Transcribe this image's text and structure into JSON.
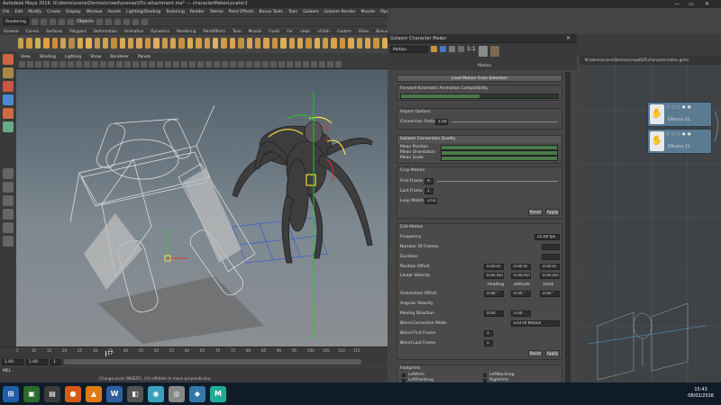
{
  "maya": {
    "title": "Autodesk Maya 2016: N:\\demo\\scene\\Demos\\crowd\\scenes\\05c-attachment.ma* --- characterMakerLocator1",
    "menus": [
      "File",
      "Edit",
      "Modify",
      "Create",
      "Display",
      "Window",
      "Assets",
      "Lighting/Shading",
      "Texturing",
      "Render",
      "Stereo",
      "Paint Effects",
      "Bonus Tools",
      "Toon",
      "Golaem",
      "Golaem Render",
      "Muscle",
      "Pipeline Cache",
      "Help"
    ],
    "mode_dropdown": "Rendering",
    "objects_label": "Objects",
    "shelf_tabs": [
      "General",
      "Curves",
      "Surfaces",
      "Polygons",
      "Deformation",
      "Animation",
      "Dynamics",
      "Rendering",
      "PaintEffects",
      "Toon",
      "Muscle",
      "Fluids",
      "Fur",
      "nHair",
      "nCloth",
      "Custom",
      "XGen",
      "Bonus",
      "Golaem"
    ],
    "shelf_colors": [
      "#c7a05a",
      "#d89a3a",
      "#c8b060",
      "#e0a040",
      "#d48b36",
      "#caa35b",
      "#b58a45",
      "#d6aa55",
      "#e2b25a",
      "#c9954a",
      "#d8a048",
      "#c58c40",
      "#dba854",
      "#cfa04d",
      "#d9a35a",
      "#c7973f",
      "#e0ad5c",
      "#cd9a48",
      "#d4a453",
      "#c8923e",
      "#dcaa55",
      "#d39c46",
      "#c99a4c",
      "#e1b15d",
      "#cf9b47",
      "#d6a552",
      "#c48f3f",
      "#daa651",
      "#cc9849",
      "#d7a250",
      "#c99443",
      "#ddb059",
      "#d09d48",
      "#d8a455",
      "#c6923f",
      "#e0ad5a",
      "#ce9a47",
      "#d5a352",
      "#ca9644",
      "#dcaa56",
      "#d19d49",
      "#d7a453",
      "#c7943f",
      "#dfac59"
    ],
    "panel_menus": [
      "View",
      "Shading",
      "Lighting",
      "Show",
      "Renderer",
      "Panels"
    ],
    "time_current": "17",
    "timeline_ticks": [
      "5",
      "10",
      "15",
      "20",
      "25",
      "30",
      "35",
      "40",
      "45",
      "50",
      "55",
      "60",
      "65",
      "70",
      "75",
      "80",
      "85",
      "90",
      "95",
      "100",
      "105",
      "110",
      "115"
    ],
    "range_start": "1.00",
    "range_inner": "1.00",
    "range_field": "1",
    "cmd_label": "MEL",
    "help_text": "Change pivot (INSERT). Ctrl+Middle to move perpendicular."
  },
  "golaem": {
    "window_title": "Golaem Character Maker",
    "motion_dropdown": "Motion",
    "toolbar_ratio": "1:1",
    "sub_label": "Motion",
    "load_button": "Load Motion From Selection",
    "fk_label": "Forward Kinematic Animation Compatibility",
    "fk_value": 0.5,
    "import_options": "Import Options",
    "conversion_factor_label": "Conversion Factor",
    "conversion_factor": "1.00",
    "quality_header": "Golaem Conversion Quality",
    "mean_position": "Mean Position",
    "mean_orientation": "Mean Orientation",
    "mean_scale": "Mean Scale",
    "crop_motion": "Crop Motion",
    "first_frame_label": "First Frame",
    "first_frame": "9",
    "last_frame_label": "Last Frame",
    "last_frame": "1",
    "loop_match_label": "Loop Match",
    "loop_match": "3710",
    "reset_label": "Reset",
    "apply_label": "Apply",
    "edit_motion": "Edit Motion",
    "frequency_label": "Frequency",
    "frequency": "25.00 fps",
    "num_frames_label": "Number Of Frames",
    "num_frames": "",
    "duration_label": "Duration",
    "position_offset_label": "Position Offset",
    "position_offset": [
      "0.00 m",
      "0.00 m",
      "0.00 m"
    ],
    "linear_velocity_label": "Linear Velocity",
    "linear_velocity": [
      "0.00 m/s",
      "0.00 m/s",
      "0.00 m/s"
    ],
    "hab_headers": [
      "heading",
      "attitude",
      "bank"
    ],
    "orientation_offset_label": "Orientation Offset",
    "orientation_offset": [
      "0.00 °",
      "0.00 °",
      "0.00 °"
    ],
    "angular_velocity_label": "Angular Velocity",
    "moving_direction_label": "Moving Direction",
    "moving_direction": [
      "0.00",
      "0.00"
    ],
    "blend_correction_label": "Blend Correction Mode",
    "blend_correction": "End Of Motion",
    "blend_first_label": "Blend First Frame",
    "blend_first": "1",
    "blend_last_label": "Blend Last Frame",
    "blend_last": "1",
    "footprints": "Footprints",
    "foot_items": [
      "LeftArm",
      "LeftBackLeg",
      "LeftFrontLeg",
      "RightArm"
    ]
  },
  "node_editor": {
    "path": "N:\\demo\\scene\\Demos\\crowd\\05\\characters\\alien.gcha",
    "effector1": "Effector 01",
    "effector2": "Effector 11"
  },
  "taskbar": {
    "time": "15:43",
    "date": "08/02/2016"
  }
}
